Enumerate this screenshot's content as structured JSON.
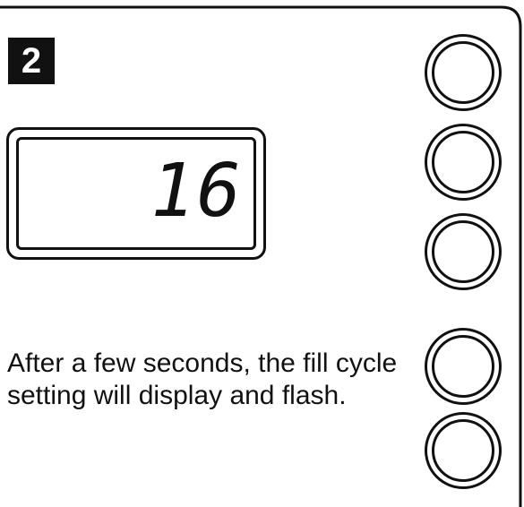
{
  "step": {
    "number": "2"
  },
  "display": {
    "readout": "16"
  },
  "instruction": {
    "line1": "After a few seconds, the fill cycle",
    "line2": "setting will display and flash."
  },
  "buttons": [
    {
      "name": "panel-button-1"
    },
    {
      "name": "panel-button-2"
    },
    {
      "name": "panel-button-3"
    },
    {
      "name": "panel-button-4"
    },
    {
      "name": "panel-button-5"
    }
  ]
}
